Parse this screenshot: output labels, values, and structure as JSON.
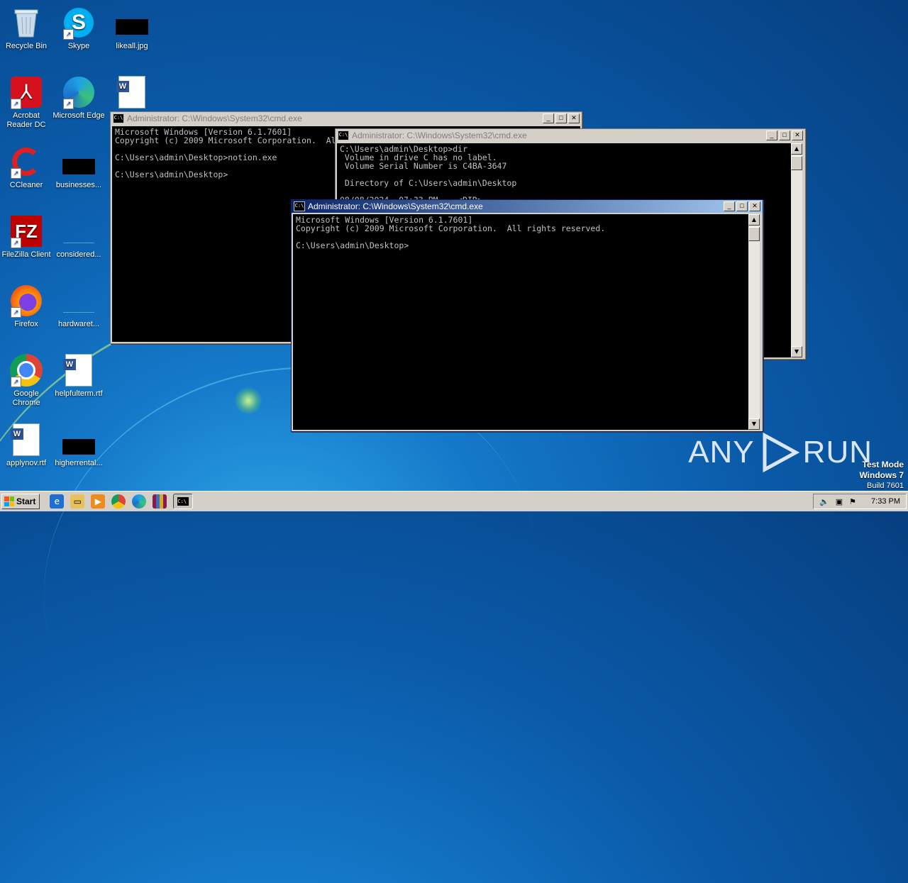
{
  "desktop": {
    "icons": [
      {
        "label": "Recycle Bin",
        "icon": "recycle-bin-icon"
      },
      {
        "label": "Skype",
        "icon": "skype-icon"
      },
      {
        "label": "likeall.jpg",
        "icon": "image-file-icon"
      },
      {
        "label": "Acrobat Reader DC",
        "icon": "acrobat-icon"
      },
      {
        "label": "Microsoft Edge",
        "icon": "edge-icon"
      },
      {
        "label": "",
        "icon": "word-document-icon"
      },
      {
        "label": "CCleaner",
        "icon": "ccleaner-icon"
      },
      {
        "label": "businesses...",
        "icon": "file-icon"
      },
      {
        "label": "FileZilla Client",
        "icon": "filezilla-icon"
      },
      {
        "label": "considered...",
        "icon": "file-icon"
      },
      {
        "label": "Firefox",
        "icon": "firefox-icon"
      },
      {
        "label": "hardwaret...",
        "icon": "file-icon"
      },
      {
        "label": "Google Chrome",
        "icon": "chrome-icon"
      },
      {
        "label": "helpfulterm.rtf",
        "icon": "rtf-document-icon"
      },
      {
        "label": "applynov.rtf",
        "icon": "rtf-document-icon"
      },
      {
        "label": "higherrental...",
        "icon": "file-icon"
      }
    ]
  },
  "windows": {
    "back": {
      "title": "Administrator: C:\\Windows\\System32\\cmd.exe",
      "output": "Microsoft Windows [Version 6.1.7601]\nCopyright (c) 2009 Microsoft Corporation.  All rights reserved.\n\nC:\\Users\\admin\\Desktop>notion.exe\n\nC:\\Users\\admin\\Desktop>"
    },
    "middle": {
      "title": "Administrator: C:\\Windows\\System32\\cmd.exe",
      "output": "C:\\Users\\admin\\Desktop>dir\n Volume in drive C has no label.\n Volume Serial Number is C4BA-3647\n\n Directory of C:\\Users\\admin\\Desktop\n\n08/08/2024  07:33 PM    <DIR>          ."
    },
    "front": {
      "title": "Administrator: C:\\Windows\\System32\\cmd.exe",
      "output": "Microsoft Windows [Version 6.1.7601]\nCopyright (c) 2009 Microsoft Corporation.  All rights reserved.\n\nC:\\Users\\admin\\Desktop>"
    },
    "buttons": {
      "minimize": "_",
      "maximize": "□",
      "close": "✕"
    }
  },
  "taskbar": {
    "start_label": "Start",
    "quick_launch": [
      "ie-icon",
      "explorer-icon",
      "media-player-icon",
      "chrome-icon",
      "edge-icon",
      "winrar-icon",
      "cmd-icon"
    ],
    "clock": "7:33 PM"
  },
  "watermark": {
    "text_left": "ANY",
    "text_right": "RUN"
  },
  "test_mode": {
    "line1": "Test Mode",
    "line2": "Windows 7",
    "line3": "Build 7601"
  },
  "colors": {
    "titlebar_active": "#0a246a",
    "desktop_blue": "#0a5aa8"
  }
}
